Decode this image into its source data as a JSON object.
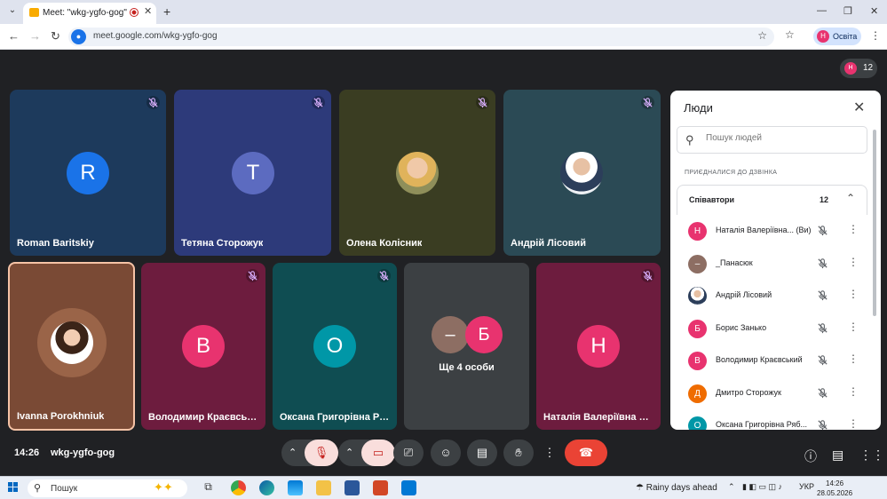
{
  "browser": {
    "tab_title": "Meet: \"wkg-ygfo-gog\"",
    "url": "meet.google.com/wkg-ygfo-gog",
    "profile_name": "Освіта",
    "profile_initial": "Н"
  },
  "meeting": {
    "participant_count": "12",
    "time": "14:26",
    "code": "wkg-ygfo-gog"
  },
  "tiles": [
    {
      "name": "Roman Baritskiy",
      "initial": "R",
      "avatar_color": "#1a73e8",
      "bg": "#1d3a5c"
    },
    {
      "name": "Тетяна Сторожук",
      "initial": "T",
      "avatar_color": "#5c6bc0",
      "bg": "#2d3a7a"
    },
    {
      "name": "Олена Колісник",
      "initial": "",
      "avatar_color": "#d4a373",
      "bg": "#3a3d22"
    },
    {
      "name": "Андрій Лісовий",
      "initial": "",
      "avatar_color": "#ffffff",
      "bg": "#2b4a55"
    },
    {
      "name": "Ivanna Porokhniuk",
      "initial": "",
      "avatar_color": "#f1e4dc",
      "bg": "#7a4a35"
    },
    {
      "name": "Володимир Краєвськ...",
      "initial": "В",
      "avatar_color": "#e8336f",
      "bg": "#6d1c3e"
    },
    {
      "name": "Оксана Григорівна Ря...",
      "initial": "О",
      "avatar_color": "#0097a7",
      "bg": "#0f4d52"
    },
    {
      "name": "Ще 4 особи",
      "initial_a": "–",
      "initial_b": "Б",
      "color_a": "#8d6e63",
      "color_b": "#e8336f",
      "bg": "#3c4043"
    },
    {
      "name": "Наталія Валеріївна Гу...",
      "initial": "Н",
      "avatar_color": "#e8336f",
      "bg": "#6d1c3e"
    }
  ],
  "panel": {
    "title": "Люди",
    "search_placeholder": "Пошук людей",
    "section": "ПРИЄДНАЛИСЯ ДО ДЗВІНКА",
    "group_label": "Співавтори",
    "group_count": "12",
    "people": [
      {
        "name": "Наталія Валеріївна...  (Ви)",
        "initial": "Н",
        "color": "#e8336f"
      },
      {
        "name": "_Панасюк",
        "initial": "–",
        "color": "#8d6e63"
      },
      {
        "name": "Андрій Лісовий",
        "initial": "",
        "color": "#dfe6ee"
      },
      {
        "name": "Борис Занько",
        "initial": "Б",
        "color": "#e8336f"
      },
      {
        "name": "Володимир Краєвський",
        "initial": "В",
        "color": "#e8336f"
      },
      {
        "name": "Дмитро Сторожук",
        "initial": "Д",
        "color": "#ef6c00"
      },
      {
        "name": "Оксана Григорівна Ряб...",
        "initial": "О",
        "color": "#0097a7"
      }
    ]
  },
  "taskbar": {
    "search_label": "Пошук",
    "weather": "Rainy days ahead",
    "lang": "УКР",
    "time": "14:26",
    "date": "28.05.2026"
  }
}
